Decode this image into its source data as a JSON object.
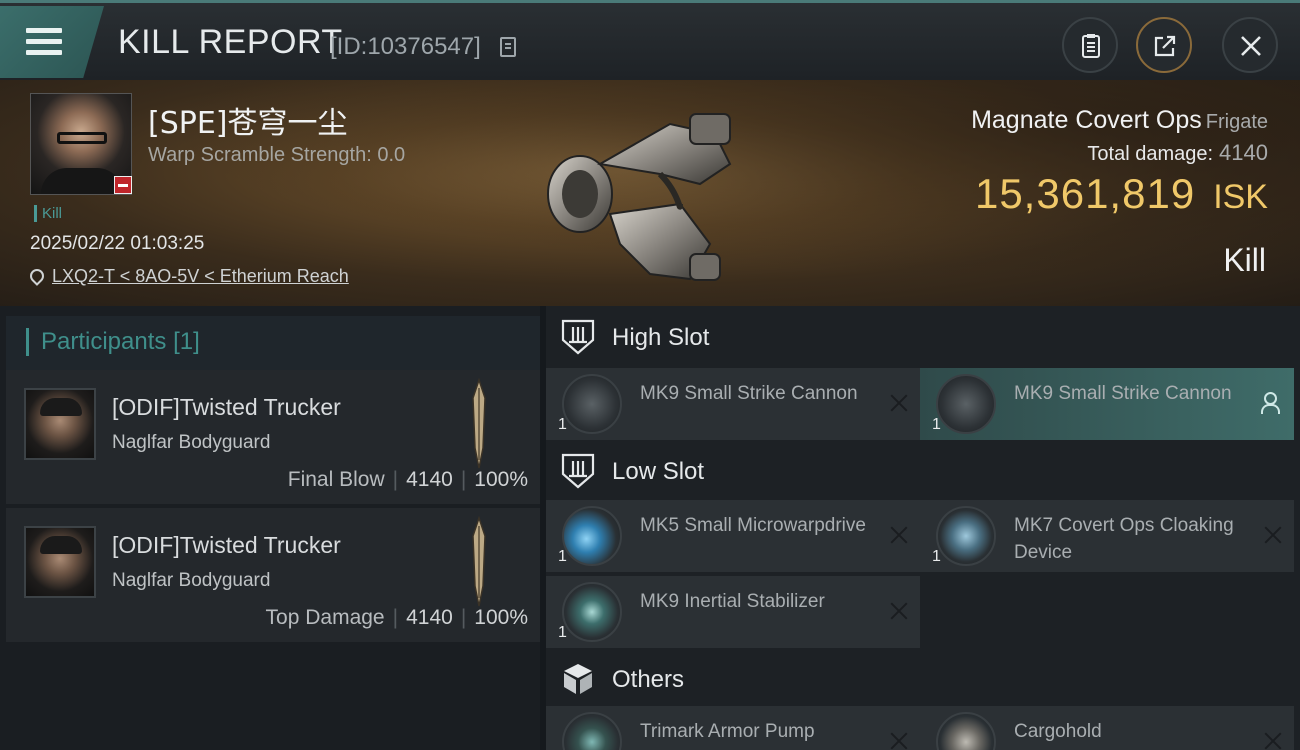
{
  "header": {
    "title": "KILL REPORT",
    "report_id": "[ID:10376547]",
    "icons": [
      "menu-icon",
      "copy-icon",
      "clipboard-icon",
      "share-icon",
      "close-icon"
    ]
  },
  "victim": {
    "name": "[SPE]苍穹一尘",
    "warp_scramble": "Warp Scramble Strength: 0.0",
    "tag": "Kill",
    "datetime": "2025/02/22 01:03:25",
    "location": "LXQ2-T < 8AO-5V < Etherium Reach",
    "ship_name": "Magnate Covert Ops",
    "ship_class": "Frigate",
    "total_damage_label": "Total damage:",
    "total_damage_value": "4140",
    "isk_value": "15,361,819",
    "isk_unit": "ISK",
    "result": "Kill"
  },
  "participants": {
    "label": "Participants",
    "count": "[1]",
    "items": [
      {
        "name": "[ODIF]Twisted Trucker",
        "ship": "Naglfar Bodyguard",
        "role": "Final Blow",
        "damage": "4140",
        "percent": "100%"
      },
      {
        "name": "[ODIF]Twisted Trucker",
        "ship": "Naglfar Bodyguard",
        "role": "Top Damage",
        "damage": "4140",
        "percent": "100%"
      }
    ]
  },
  "fittings": {
    "high_slot": {
      "title": "High Slot",
      "items": [
        {
          "name": "MK9 Small Strike Cannon",
          "qty": "1"
        },
        {
          "name": "MK9 Small Strike Cannon",
          "qty": "1"
        }
      ]
    },
    "low_slot": {
      "title": "Low Slot",
      "items": [
        {
          "name": "MK5 Small Microwarpdrive",
          "qty": "1"
        },
        {
          "name": "MK7 Covert Ops Cloaking Device",
          "qty": "1"
        },
        {
          "name": "MK9 Inertial Stabilizer",
          "qty": "1"
        }
      ]
    },
    "others": {
      "title": "Others",
      "items": [
        {
          "name": "Trimark Armor Pump"
        },
        {
          "name": "Cargohold"
        }
      ]
    }
  },
  "colors": {
    "accent_teal": "#3f8f8b",
    "isk_gold": "#f0c869",
    "badge_red": "#c0262b"
  }
}
